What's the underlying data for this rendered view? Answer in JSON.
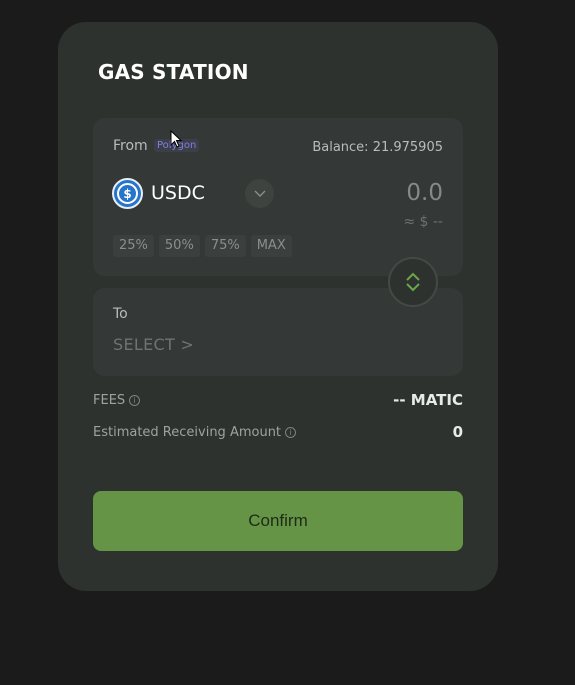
{
  "card": {
    "title": "GAS STATION"
  },
  "from": {
    "label": "From",
    "chain": "Polygon",
    "balance": "Balance: 21.975905",
    "token": {
      "symbol": "USDC",
      "icon": "usdc-icon"
    },
    "amount": "0.0",
    "usd_value": "≈ $ --",
    "percent_buttons": [
      "25%",
      "50%",
      "75%",
      "MAX"
    ]
  },
  "to": {
    "label": "To",
    "select_label": "SELECT >"
  },
  "fees": {
    "label": "FEES",
    "value": "-- MATIC"
  },
  "estimated": {
    "label": "Estimated Receiving Amount",
    "value": "0"
  },
  "confirm_label": "Confirm",
  "colors": {
    "background": "#1b1b1b",
    "card": "#2e322f",
    "panel": "#343836",
    "accent_green": "#659446",
    "usdc_blue": "#2775ca",
    "chain_badge_text": "#7f7fe0"
  }
}
